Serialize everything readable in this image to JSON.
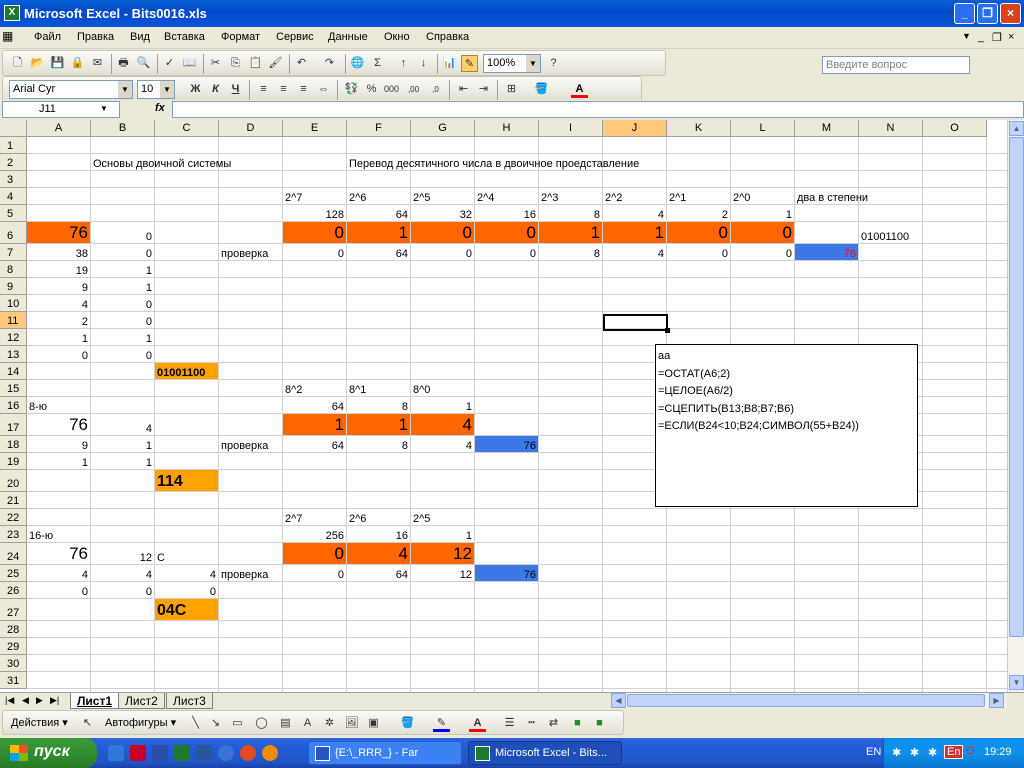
{
  "window": {
    "title": "Microsoft Excel - Bits0016.xls"
  },
  "menu": {
    "items": [
      "Файл",
      "Правка",
      "Вид",
      "Вставка",
      "Формат",
      "Сервис",
      "Данные",
      "Окно",
      "Справка"
    ],
    "ask_placeholder": "Введите вопрос"
  },
  "toolbar": {
    "zoom": "100%",
    "font": "Arial Cyr",
    "size": "10"
  },
  "formula": {
    "name_box": "J11",
    "fx": "fx",
    "value": ""
  },
  "columns": [
    "A",
    "B",
    "C",
    "D",
    "E",
    "F",
    "G",
    "H",
    "I",
    "J",
    "K",
    "L",
    "M",
    "N",
    "O"
  ],
  "rows": [
    "1",
    "2",
    "3",
    "4",
    "5",
    "6",
    "7",
    "8",
    "9",
    "10",
    "11",
    "12",
    "13",
    "14",
    "15",
    "16",
    "17",
    "18",
    "19",
    "20",
    "21",
    "22",
    "23",
    "24",
    "25",
    "26",
    "27",
    "28",
    "29",
    "30",
    "31"
  ],
  "selected": {
    "col": "J",
    "row": "11"
  },
  "cells": {
    "B2": "Основы двоичной системы",
    "F2": "Перевод десятичного числа в двоичное проедставление",
    "E4": "2^7",
    "F4": "2^6",
    "G4": "2^5",
    "H4": "2^4",
    "I4": "2^3",
    "J4": "2^2",
    "K4": "2^1",
    "L4": "2^0",
    "M4": "два в степени",
    "E5": "128",
    "F5": "64",
    "G5": "32",
    "H5": "16",
    "I5": "8",
    "J5": "4",
    "K5": "2",
    "L5": "1",
    "A6": "76",
    "B6": "0",
    "E6": "0",
    "F6": "1",
    "G6": "0",
    "H6": "0",
    "I6": "1",
    "J6": "1",
    "K6": "0",
    "L6": "0",
    "N6": "01001100",
    "A7": "38",
    "B7": "0",
    "D7": "проверка",
    "E7": "0",
    "F7": "64",
    "G7": "0",
    "H7": "0",
    "I7": "8",
    "J7": "4",
    "K7": "0",
    "L7": "0",
    "M7": "76",
    "A8": "19",
    "B8": "1",
    "A9": "9",
    "B9": "1",
    "A10": "4",
    "B10": "0",
    "A11": "2",
    "B11": "0",
    "A12": "1",
    "B12": "1",
    "A13": "0",
    "B13": "0",
    "C14": "01001100",
    "E15": "8^2",
    "F15": "8^1",
    "G15": "8^0",
    "A16": "8-ю",
    "E16": "64",
    "F16": "8",
    "G16": "1",
    "A17": "76",
    "B17": "4",
    "E17": "1",
    "F17": "1",
    "G17": "4",
    "A18": "9",
    "B18": "1",
    "D18": "проверка",
    "E18": "64",
    "F18": "8",
    "G18": "4",
    "H18": "76",
    "A19": "1",
    "B19": "1",
    "C20": "114",
    "E22": "2^7",
    "F22": "2^6",
    "G22": "2^5",
    "A23": "16-ю",
    "E23": "256",
    "F23": "16",
    "G23": "1",
    "A24": "76",
    "B24": "12",
    "C24": "C",
    "E24": "0",
    "F24": "4",
    "G24": "12",
    "A25": "4",
    "B25": "4",
    "C25": "4",
    "D25": "проверка",
    "E25": "0",
    "F25": "64",
    "G25": "12",
    "H25": "76",
    "A26": "0",
    "B26": "0",
    "C26": "0",
    "C27": "04C"
  },
  "comment": {
    "lines": [
      "aa",
      "=ОСТАТ(A6;2)",
      "=ЦЕЛОЕ(A6/2)",
      "=СЦЕПИТЬ(B13;B8;B7;B6)",
      "=ЕСЛИ(B24<10;B24;СИМВОЛ(55+B24))"
    ]
  },
  "sheets": [
    "Лист1",
    "Лист2",
    "Лист3"
  ],
  "drawing": {
    "actions": "Действия",
    "autoshapes": "Автофигуры"
  },
  "taskbar": {
    "start": "пуск",
    "tasks": [
      "{E:\\_RRR_} - Far",
      "Microsoft Excel - Bits..."
    ],
    "lang": "EN",
    "clock": "19:29",
    "tray_lang": "En"
  },
  "colors": {
    "orange": "#ff6600",
    "yellow": "#ffa200",
    "blue": "#3c78e6",
    "m7_text": "#ff0000"
  }
}
